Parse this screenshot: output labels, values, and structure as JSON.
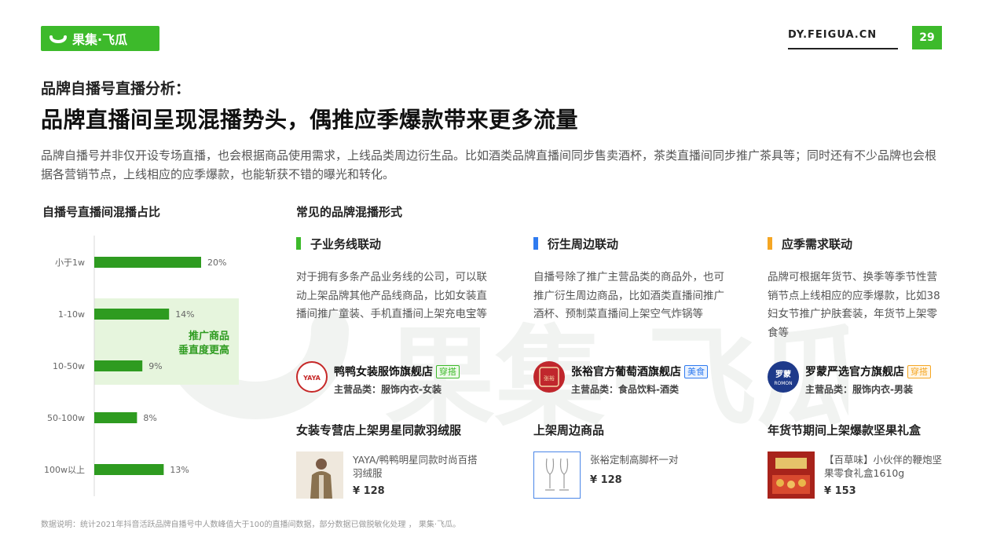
{
  "header": {
    "logo_text": "果集·飞瓜",
    "site": "DY.FEIGUA.CN",
    "page_number": "29",
    "accent_color": "#3dba2b"
  },
  "subtitle": "品牌自播号直播分析：",
  "title": "品牌直播间呈现混播势头，偶推应季爆款带来更多流量",
  "description": "品牌自播号并非仅开设专场直播，也会根据商品使用需求，上线品类周边衍生品。比如酒类品牌直播间同步售卖酒杯，茶类直播间同步推广茶具等；同时还有不少品牌也会根据各营销节点，上线相应的应季爆款，也能斩获不错的曝光和转化。",
  "left_section": {
    "title": "自播号直播间混播占比",
    "highlight": [
      "推广商品",
      "垂直度更高"
    ]
  },
  "chart_data": {
    "type": "bar",
    "orientation": "horizontal",
    "categories": [
      "小于1w",
      "1-10w",
      "10-50w",
      "50-100w",
      "100w以上"
    ],
    "values": [
      20,
      14,
      9,
      8,
      13
    ],
    "value_labels": [
      "20%",
      "14%",
      "9%",
      "8%",
      "13%"
    ],
    "unit": "%",
    "color": "#2e9b20"
  },
  "right_section": {
    "title": "常见的品牌混播形式",
    "columns": [
      {
        "heading": "子业务线联动",
        "bar_color": "#3dba2b",
        "text": "对于拥有多条产品业务线的公司，可以联动上架品牌其他产品线商品，比如女装直播间推广童装、手机直播间上架充电宝等",
        "store": {
          "name": "鸭鸭女装服饰旗舰店",
          "tag": "穿搭",
          "tag_color": "#3dba2b",
          "category": "主营品类：服饰内衣-女装",
          "avatar_text": "YAYA鸭鸭"
        },
        "product_title": "女装专营店上架男星同款羽绒服",
        "product": {
          "name": "YAYA/鸭鸭明星同款时尚百搭羽绒服",
          "price": "¥ 128"
        }
      },
      {
        "heading": "衍生周边联动",
        "bar_color": "#2f7bf0",
        "text": "自播号除了推广主营品类的商品外，也可推广衍生周边商品，比如酒类直播间推广酒杯、预制菜直播间上架空气炸锅等",
        "store": {
          "name": "张裕官方葡萄酒旗舰店",
          "tag": "美食",
          "tag_color": "#2f7bf0",
          "category": "主营品类：食品饮料-酒类",
          "avatar_text": "张裕 CHANGYU"
        },
        "product_title": "上架周边商品",
        "product": {
          "name": "张裕定制高脚杯一对",
          "price": "¥ 128"
        }
      },
      {
        "heading": "应季需求联动",
        "bar_color": "#f5a623",
        "text": "品牌可根据年货节、换季等季节性营销节点上线相应的应季爆款，比如38妇女节推广护肤套装，年货节上架零食等",
        "store": {
          "name": "罗蒙严选官方旗舰店",
          "tag": "穿搭",
          "tag_color": "#f5a623",
          "category": "主营品类：服饰内衣-男装",
          "avatar_text": "罗蒙 ROMON"
        },
        "product_title": "年货节期间上架爆款坚果礼盒",
        "product": {
          "name": "【百草味】小伙伴的鞭炮坚果零食礼盒1610g",
          "price": "¥ 153"
        }
      }
    ]
  },
  "footnote": "数据说明：统计2021年抖音活跃品牌自播号中人数峰值大于100的直播间数据，部分数据已做脱敏化处理 ， 果集·飞瓜。"
}
